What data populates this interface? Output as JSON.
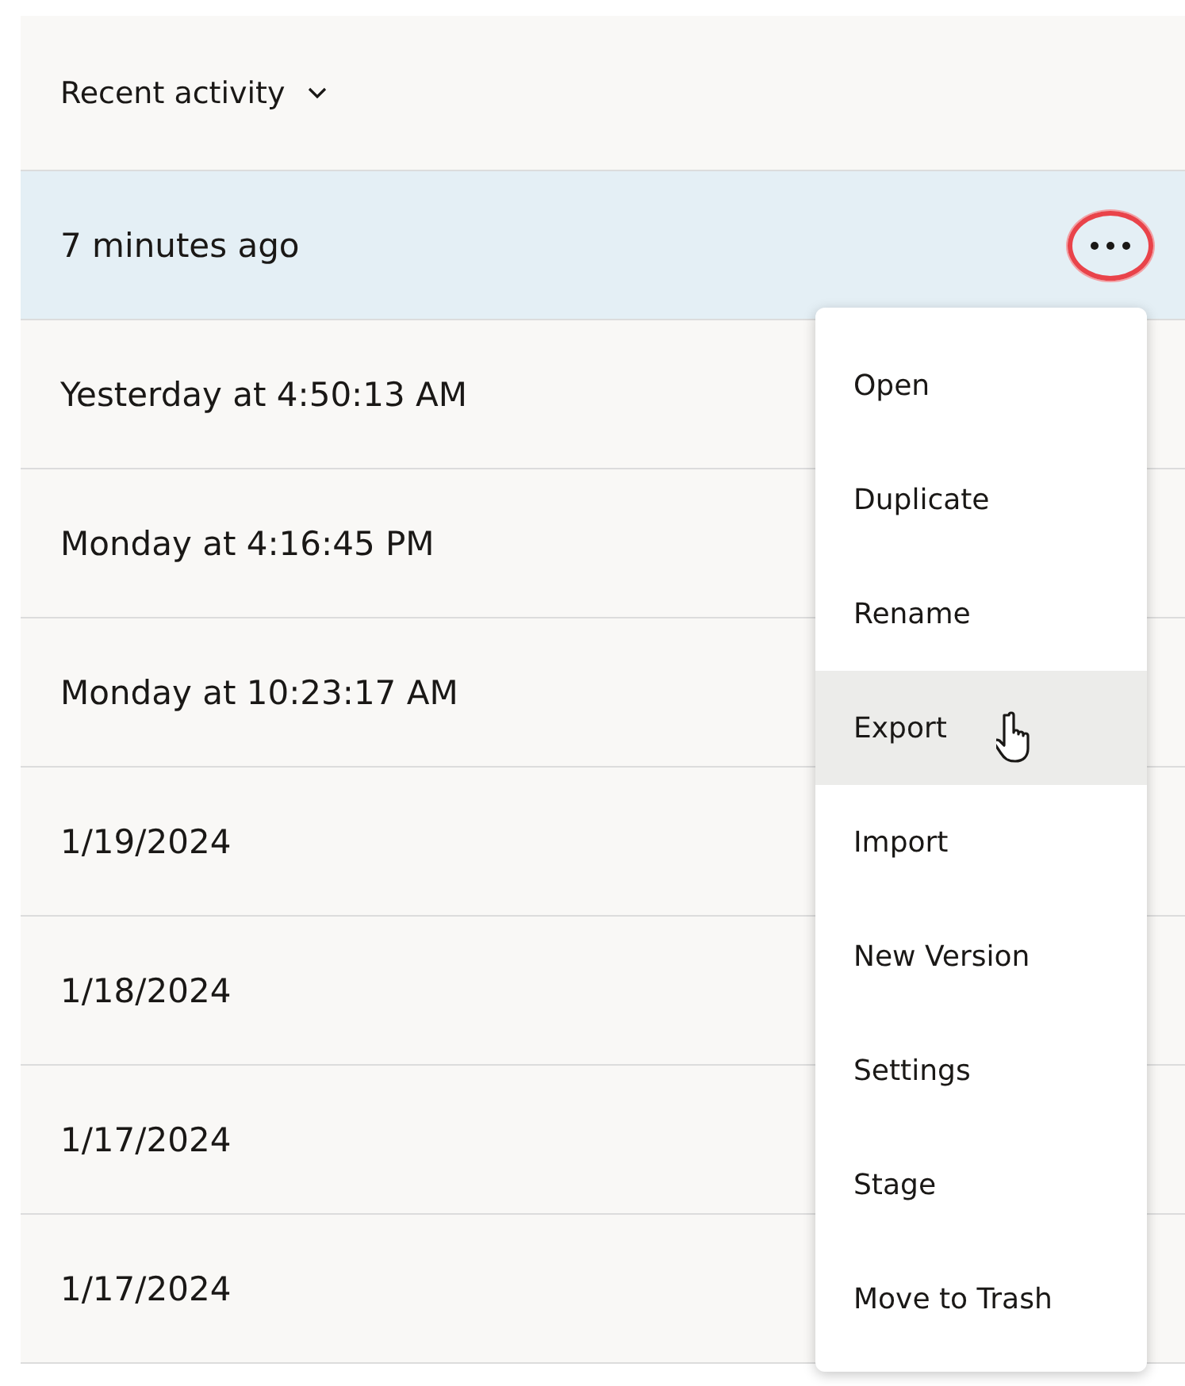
{
  "header": {
    "label": "Recent activity"
  },
  "more_button": {
    "circled": true
  },
  "rows": [
    {
      "time": "7 minutes ago",
      "selected": true
    },
    {
      "time": "Yesterday at 4:50:13 AM",
      "selected": false
    },
    {
      "time": "Monday at 4:16:45 PM",
      "selected": false
    },
    {
      "time": "Monday at 10:23:17 AM",
      "selected": false
    },
    {
      "time": "1/19/2024",
      "selected": false
    },
    {
      "time": "1/18/2024",
      "selected": false
    },
    {
      "time": "1/17/2024",
      "selected": false
    },
    {
      "time": "1/17/2024",
      "selected": false
    }
  ],
  "menu": [
    {
      "label": "Open",
      "hovered": false
    },
    {
      "label": "Duplicate",
      "hovered": false
    },
    {
      "label": "Rename",
      "hovered": false
    },
    {
      "label": "Export",
      "hovered": true
    },
    {
      "label": "Import",
      "hovered": false
    },
    {
      "label": "New Version",
      "hovered": false
    },
    {
      "label": "Settings",
      "hovered": false
    },
    {
      "label": "Stage",
      "hovered": false
    },
    {
      "label": "Move to Trash",
      "hovered": false
    }
  ]
}
